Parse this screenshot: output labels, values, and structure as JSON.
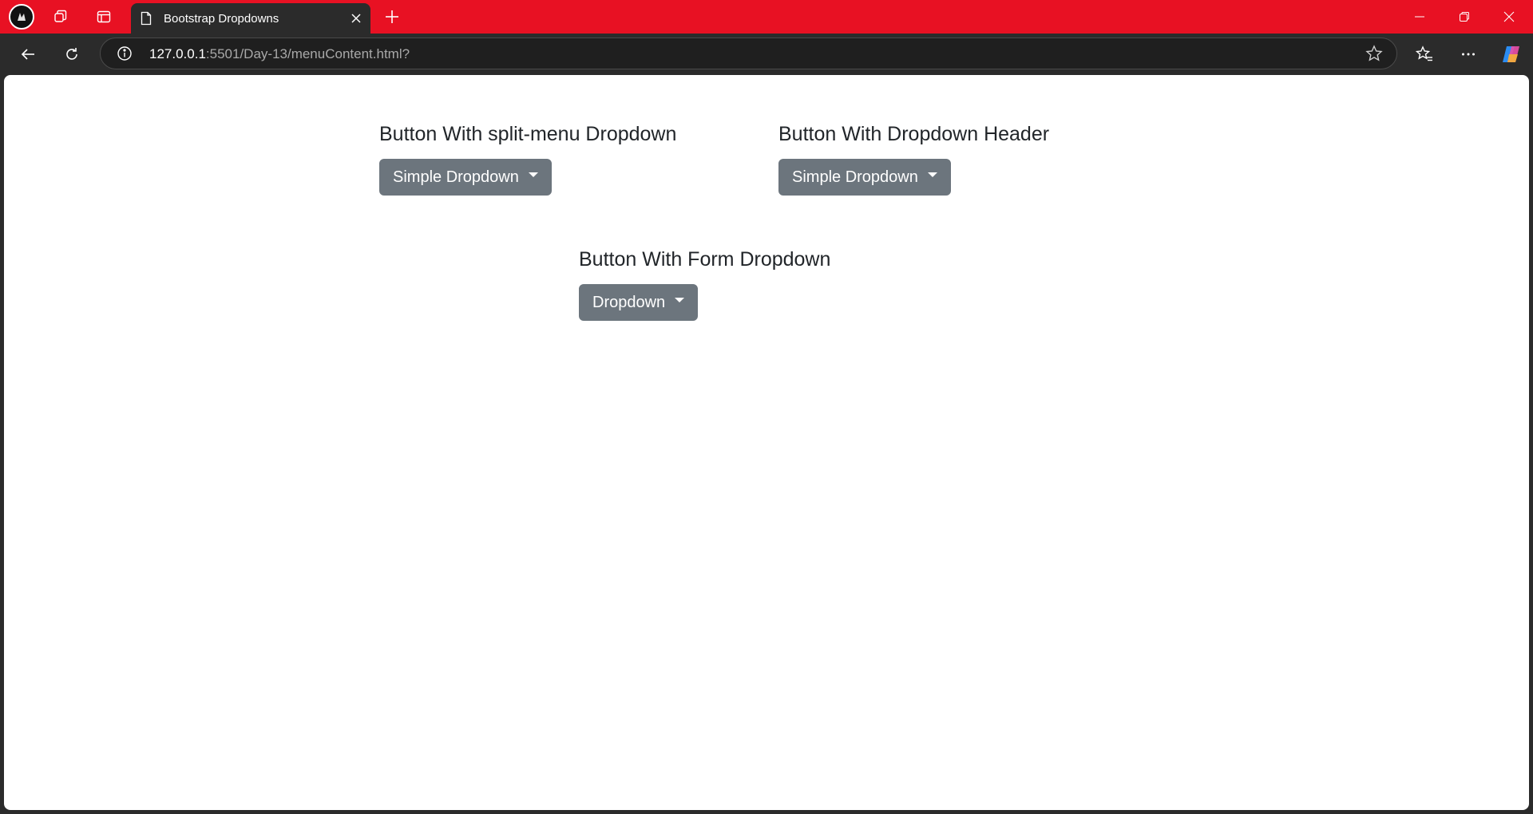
{
  "browser": {
    "tab_title": "Bootstrap Dropdowns",
    "url_host": "127.0.0.1",
    "url_rest": ":5501/Day-13/menuContent.html?"
  },
  "icons": {
    "profile": "profile-avatar-icon",
    "workspaces": "workspaces-icon",
    "vertical_tabs": "vertical-tabs-icon",
    "tab_page": "page-icon",
    "tab_close": "close-icon",
    "new_tab": "plus-icon",
    "minimize": "minimize-icon",
    "restore": "restore-icon",
    "close": "close-window-icon",
    "back": "back-arrow-icon",
    "refresh": "refresh-icon",
    "site_info": "info-icon",
    "favorite": "star-icon",
    "favorites": "favorites-icon",
    "menu": "more-icon",
    "copilot": "copilot-icon"
  },
  "colors": {
    "titlebar": "#e81123",
    "button_secondary": "#6c757d",
    "heading_text": "#212529"
  },
  "sections": [
    {
      "heading": "Button With split-menu Dropdown",
      "button": "Simple Dropdown"
    },
    {
      "heading": "Button With Dropdown Header",
      "button": "Simple Dropdown"
    },
    {
      "heading": "Button With Form Dropdown",
      "button": "Dropdown"
    }
  ]
}
